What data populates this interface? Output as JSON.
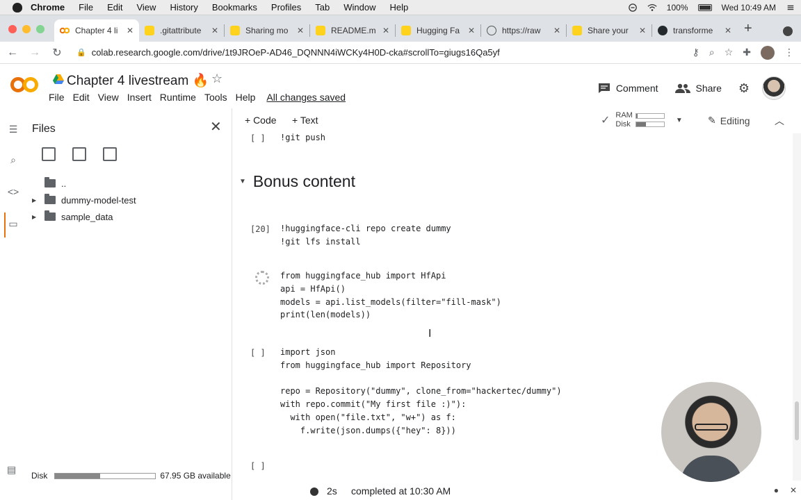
{
  "os_menubar": {
    "app": "Chrome",
    "items": [
      "File",
      "Edit",
      "View",
      "History",
      "Bookmarks",
      "Profiles",
      "Tab",
      "Window",
      "Help"
    ],
    "battery": "100%",
    "clock": "Wed 10:49 AM"
  },
  "browser": {
    "tabs": [
      {
        "label": "Chapter 4 li",
        "icon": "colab-icon",
        "active": true
      },
      {
        "label": ".gitattribute",
        "icon": "hf-icon"
      },
      {
        "label": "Sharing mo",
        "icon": "hf-icon"
      },
      {
        "label": "README.m",
        "icon": "hf-icon"
      },
      {
        "label": "Hugging Fa",
        "icon": "hf-icon"
      },
      {
        "label": "https://raw",
        "icon": "globe-icon"
      },
      {
        "label": "Share your",
        "icon": "hf-icon"
      },
      {
        "label": "transforme",
        "icon": "github-icon"
      }
    ],
    "url": "colab.research.google.com/drive/1t9JROeP-AD46_DQNNN4iWCKy4H0D-cka#scrollTo=giugs16Qa5yf"
  },
  "colab": {
    "title": "Chapter 4 livestream 🔥",
    "menus": [
      "File",
      "Edit",
      "View",
      "Insert",
      "Runtime",
      "Tools",
      "Help"
    ],
    "saved_status": "All changes saved",
    "comment_label": "Comment",
    "share_label": "Share",
    "add_code_label": "+ Code",
    "add_text_label": "+ Text",
    "ram_label": "RAM",
    "disk_label": "Disk",
    "ram_usage": 0.05,
    "disk_usage": 0.35,
    "editing_label": "Editing"
  },
  "files_panel": {
    "title": "Files",
    "tree": [
      {
        "name": "..",
        "expandable": false
      },
      {
        "name": "dummy-model-test",
        "expandable": true
      },
      {
        "name": "sample_data",
        "expandable": true
      }
    ],
    "disk_label": "Disk",
    "disk_available": "67.95 GB available",
    "disk_usage": 0.45
  },
  "notebook": {
    "top_cell": {
      "prompt": "[ ]",
      "code": "!git push"
    },
    "section_title": "Bonus content",
    "cells": [
      {
        "prompt": "[20]",
        "code": "!huggingface-cli repo create dummy\n!git lfs install"
      },
      {
        "prompt": "",
        "running": true,
        "code": "from huggingface_hub import HfApi\napi = HfApi()\nmodels = api.list_models(filter=\"fill-mask\")\nprint(len(models))"
      },
      {
        "prompt": "[ ]",
        "code": "import json\nfrom huggingface_hub import Repository\n\nrepo = Repository(\"dummy\", clone_from=\"hackertec/dummy\")\nwith repo.commit(\"My first file :)\"):\n  with open(\"file.txt\", \"w+\") as f:\n    f.write(json.dumps({\"hey\": 8}))"
      },
      {
        "prompt": "[ ]",
        "code": ""
      }
    ]
  },
  "statusbar": {
    "duration": "2s",
    "text": "completed at 10:30 AM"
  },
  "colors": {
    "colab_orange": "#f9ab00",
    "colab_orange_dark": "#e8710a",
    "tab_bg": "#dee1e6"
  }
}
